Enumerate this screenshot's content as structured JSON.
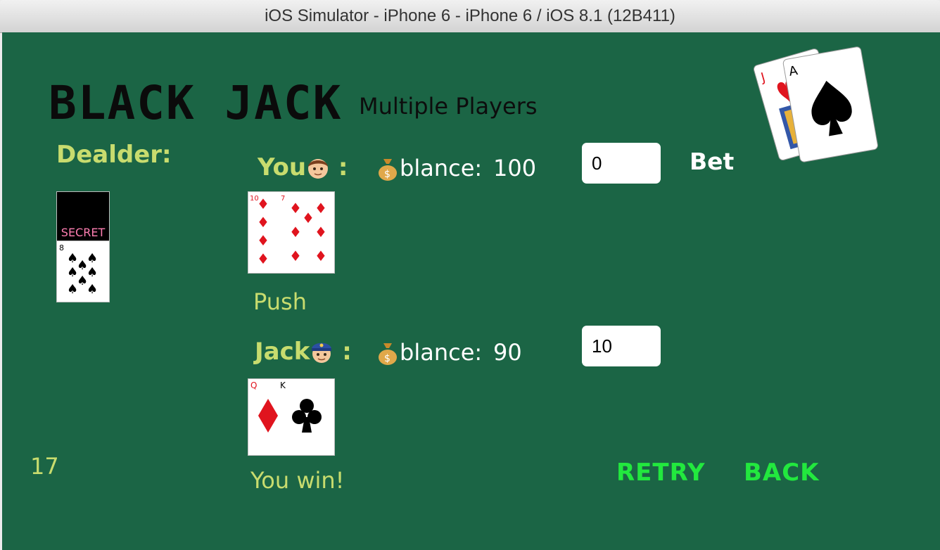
{
  "window": {
    "title": "iOS Simulator - iPhone 6 - iPhone 6 / iOS 8.1 (12B411)"
  },
  "header": {
    "title": "BLACK JACK",
    "subtitle": "Multiple Players"
  },
  "dealer": {
    "label": "Dealder:",
    "hidden_card_label": "SECRET",
    "visible_card": {
      "rank": "8",
      "suit": "spades"
    },
    "score": "17"
  },
  "players": [
    {
      "name": "You",
      "emoji": "boy-face",
      "balance_label": "blance:",
      "balance": "100",
      "bet": "0",
      "cards": [
        {
          "rank": "10",
          "suit": "diamonds"
        },
        {
          "rank": "7",
          "suit": "diamonds"
        }
      ],
      "result": "Push"
    },
    {
      "name": "Jack",
      "emoji": "police-officer",
      "balance_label": "blance:",
      "balance": "90",
      "bet": "10",
      "cards": [
        {
          "rank": "Q",
          "suit": "diamonds"
        },
        {
          "rank": "K",
          "suit": "clubs"
        }
      ],
      "result": "You win!"
    }
  ],
  "bet_label": "Bet",
  "actions": {
    "retry": "RETRY",
    "back": "BACK"
  },
  "logo_cards": [
    {
      "rank": "J",
      "suit": "hearts"
    },
    {
      "rank": "A",
      "suit": "spades"
    }
  ],
  "colors": {
    "table": "#1b6545",
    "label": "#c8dc6e",
    "action": "#22e83e",
    "red_suit": "#e0141e"
  }
}
